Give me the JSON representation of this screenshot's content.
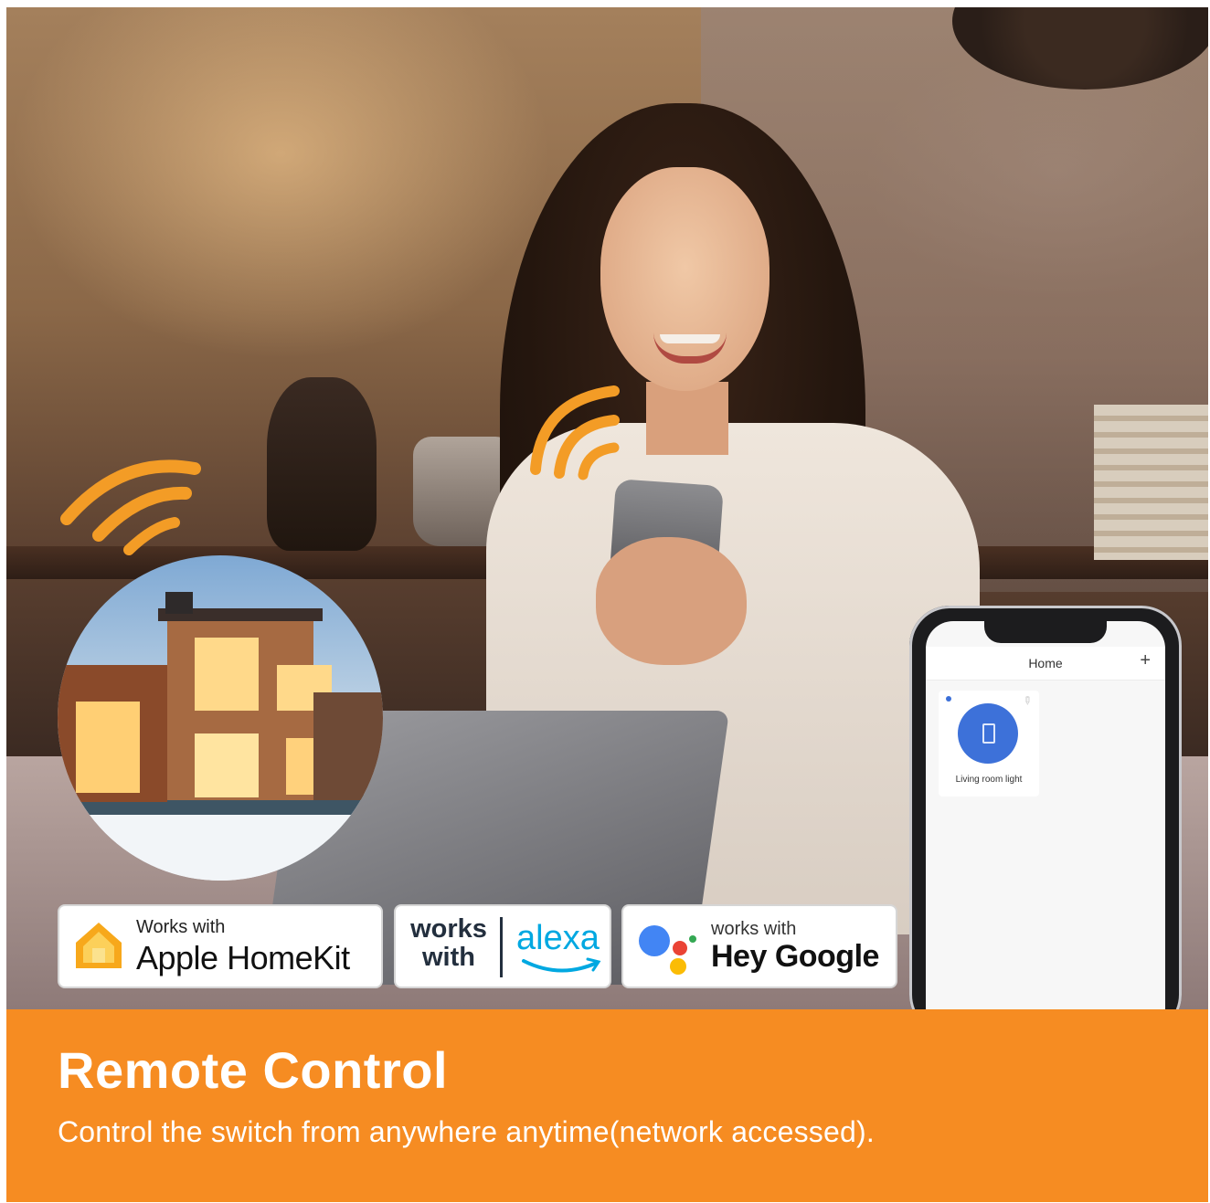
{
  "badges": {
    "homekit": {
      "small": "Works with",
      "big": "Apple HomeKit"
    },
    "alexa": {
      "works": "works",
      "with": "with",
      "brand": "alexa"
    },
    "google": {
      "small": "works with",
      "big": "Hey Google"
    }
  },
  "app": {
    "title": "Home",
    "add": "+",
    "device": {
      "label": "Living room light"
    }
  },
  "banner": {
    "title": "Remote Control",
    "subtitle": "Control the switch from anywhere anytime(network accessed)."
  },
  "colors": {
    "accent": "#f68c22",
    "device_blue": "#3d71d9",
    "alexa_blue": "#00a8e1",
    "wave": "#f39c26"
  }
}
